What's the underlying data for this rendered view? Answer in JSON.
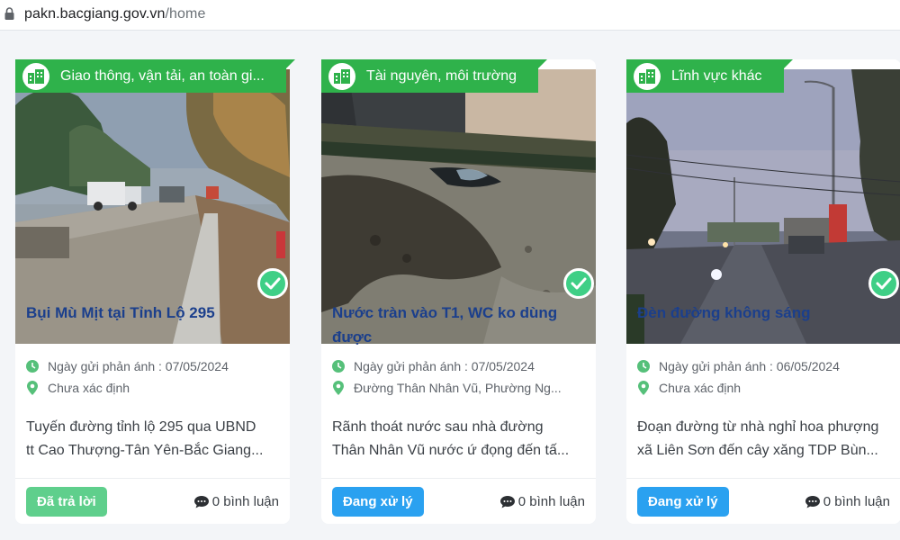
{
  "browser": {
    "url_domain": "pakn.bacgiang.gov.vn",
    "url_path": "/home"
  },
  "cards": [
    {
      "category": "Giao thông, vận tải, an toàn gi...",
      "title_lines": [
        "Bụi Mù Mịt tại Tỉnh Lộ 295"
      ],
      "date_text": "Ngày gửi phản ánh : 07/05/2024",
      "location": "Chưa xác định",
      "desc_lines": [
        "Tuyến đường tỉnh lộ 295 qua UBND",
        "tt Cao Thượng-Tân Yên-Bắc Giang..."
      ],
      "status": "Đã trả lời",
      "comments": "0 bình luận"
    },
    {
      "category": "Tài nguyên, môi trường",
      "title_lines": [
        "Nước tràn vào T1, WC ko dùng",
        "được"
      ],
      "date_text": "Ngày gửi phản ánh : 07/05/2024",
      "location": "Đường Thân Nhân Vũ, Phường Ng...",
      "desc_lines": [
        "Rãnh thoát nước sau nhà đường",
        "Thân Nhân Vũ nước ứ đọng đến tấ..."
      ],
      "status": "Đang xử lý",
      "comments": "0 bình luận"
    },
    {
      "category": "Lĩnh vực khác",
      "title_lines": [
        "Đèn đường không sáng"
      ],
      "date_text": "Ngày gửi phản ánh : 06/05/2024",
      "location": "Chưa xác định",
      "desc_lines": [
        "Đoạn đường từ nhà nghỉ hoa phượng",
        "xã Liên Sơn đến cây xăng TDP Bùn..."
      ],
      "status": "Đang xử lý",
      "comments": "0 bình luận"
    }
  ],
  "colors": {
    "category_green": "#2fb24b",
    "status_answered": "#5fcf8c",
    "status_processing": "#2aa1f0",
    "title_blue": "#1b3f8c",
    "check_green": "#3fcf86"
  },
  "icons": {
    "lock": "lock-icon",
    "category": "buildings-icon",
    "verified": "check-circle-icon",
    "date": "clock-icon",
    "location": "map-pin-icon",
    "comments": "comment-bubble-icon"
  }
}
